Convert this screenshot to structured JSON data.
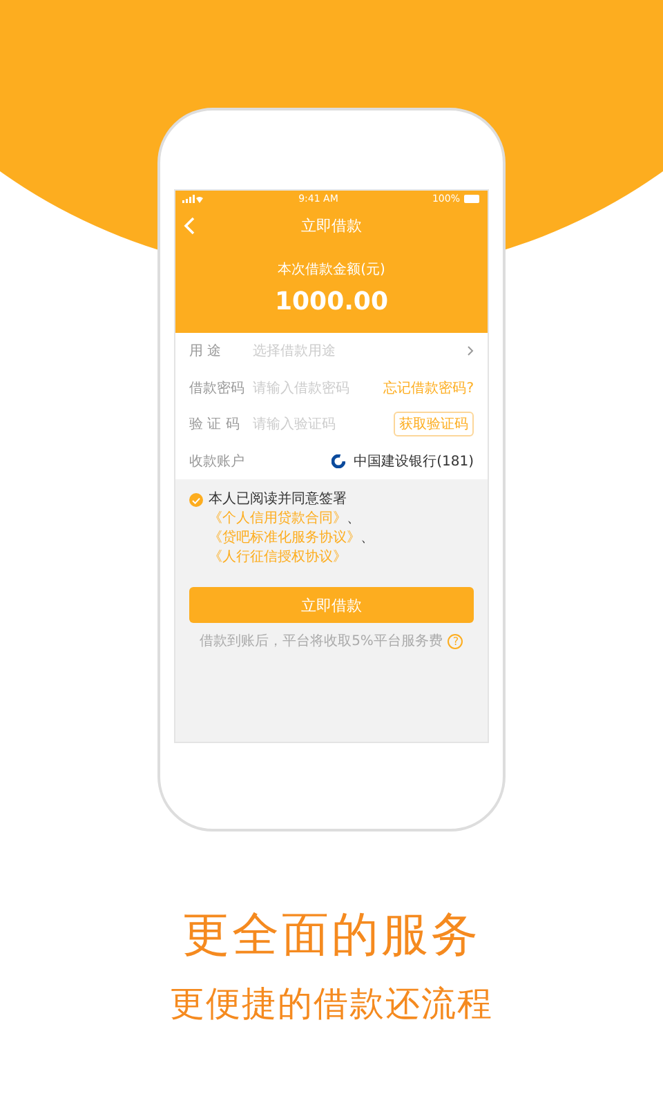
{
  "status_bar": {
    "time": "9:41 AM",
    "battery": "100%"
  },
  "nav": {
    "title": "立即借款"
  },
  "amount": {
    "label": "本次借款金额(元)",
    "value": "1000.00"
  },
  "form_rows": [
    {
      "kind": "select",
      "label": "用 途",
      "placeholder": "选择借款用途"
    },
    {
      "kind": "link",
      "label": "借款密码",
      "placeholder": "请输入借款密码",
      "action": "忘记借款密码?"
    },
    {
      "kind": "button",
      "label": "验 证 码",
      "placeholder": "请输入验证码",
      "action": "获取验证码"
    },
    {
      "kind": "account",
      "label": "收款账户",
      "value": "中国建设银行(181)"
    }
  ],
  "agreement": {
    "checked": true,
    "text": "本人已阅读并同意签署",
    "links": [
      "《个人信用贷款合同》",
      "《贷吧标准化服务协议》",
      "《人行征信授权协议》"
    ],
    "separator": "、"
  },
  "submit": "立即借款",
  "note": {
    "text": "借款到账后，平台将收取5%平台服务费",
    "help": "?"
  },
  "captions": {
    "headline": "更全面的服务",
    "subline": "更便捷的借款还流程"
  }
}
